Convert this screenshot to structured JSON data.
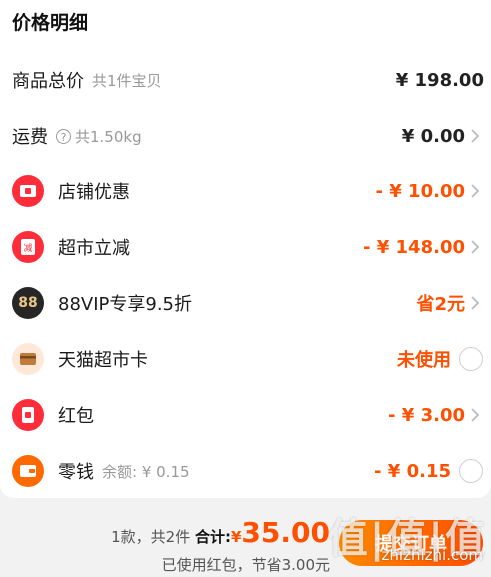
{
  "title": "价格明细",
  "rows": {
    "goods": {
      "label": "商品总价",
      "sub": "共1件宝贝",
      "value": "¥ 198.00"
    },
    "shipping": {
      "label": "运费",
      "sub": "共1.50kg",
      "value": "¥ 0.00"
    },
    "shop_discount": {
      "label": "店铺优惠",
      "value": "- ¥ 10.00"
    },
    "super_discount": {
      "label": "超市立减",
      "value": "- ¥ 148.00"
    },
    "vip": {
      "label": "88VIP专享9.5折",
      "value": "省2元",
      "icon_text": "88"
    },
    "tmall_card": {
      "label": "天猫超市卡",
      "value": "未使用"
    },
    "red_packet": {
      "label": "红包",
      "value": "- ¥ 3.00"
    },
    "change": {
      "label": "零钱",
      "sub": "余额: ¥ 0.15",
      "value": "- ¥ 0.15"
    }
  },
  "footer": {
    "count_text": "1款，共2件",
    "total_label": "合计:",
    "currency": "¥",
    "total_amount": "35.00",
    "saving_text": "已使用红包，节省3.00元",
    "submit_label": "提交订单"
  },
  "watermark": {
    "main": "值|值|值",
    "sub": "zhizhizhi.com"
  },
  "colors": {
    "accent": "#ff5000",
    "icon_red": "#ff2d3a",
    "icon_orange": "#ff6a00"
  }
}
